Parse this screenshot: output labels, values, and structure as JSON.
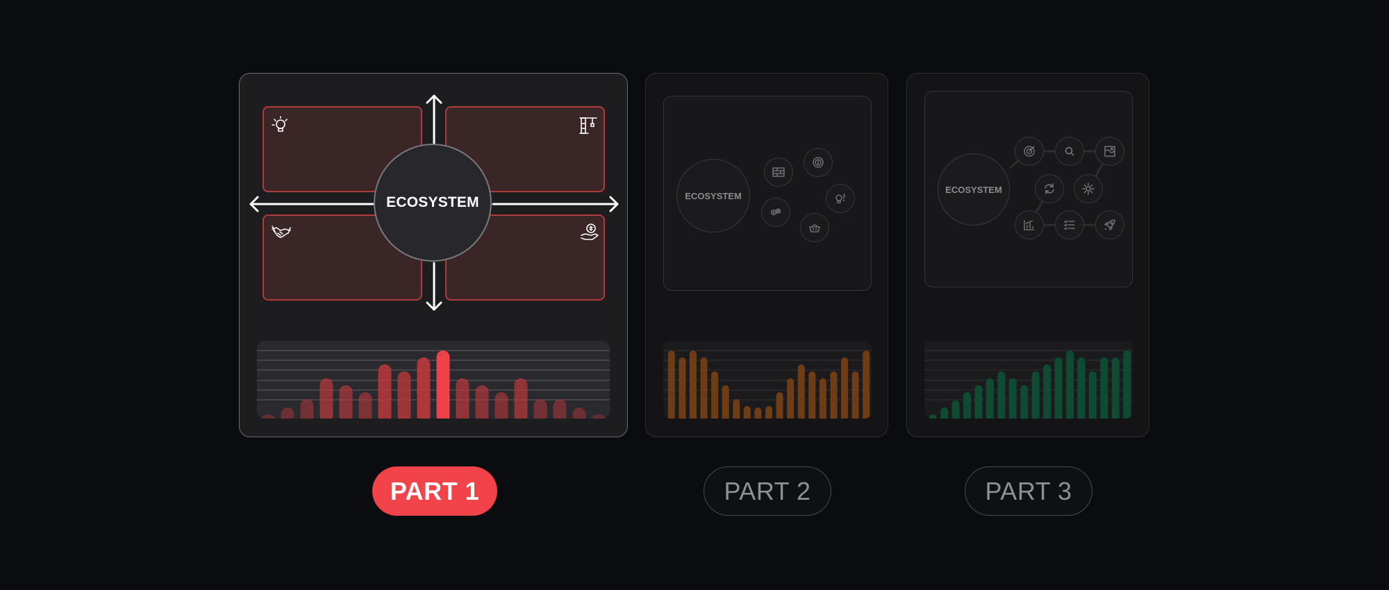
{
  "parts": [
    {
      "label": "PART 1",
      "diagram_label": "ECOSYSTEM",
      "quadrant_icons": [
        "lightbulb-idea-icon",
        "crane-icon",
        "handshake-icon",
        "money-hand-icon"
      ],
      "bars": [
        0.05,
        0.16,
        0.28,
        0.58,
        0.48,
        0.38,
        0.78,
        0.68,
        0.88,
        0.98,
        0.58,
        0.48,
        0.38,
        0.58,
        0.28,
        0.28,
        0.16,
        0.05
      ],
      "active_bar_index": 9,
      "colors": {
        "bar": "#b8383c",
        "bar_active": "#f2424a",
        "quad_border": "#b23a3d",
        "quad_fill": "#3a2527"
      }
    },
    {
      "label": "PART 2",
      "diagram_label": "ECOSYSTEM",
      "icons": [
        "bricks-icon",
        "compass-icon",
        "lightbulb-question-icon",
        "gears-icon",
        "basket-icon"
      ],
      "bars": [
        0.98,
        0.88,
        0.98,
        0.88,
        0.68,
        0.48,
        0.28,
        0.18,
        0.16,
        0.18,
        0.38,
        0.58,
        0.78,
        0.68,
        0.58,
        0.68,
        0.88,
        0.68,
        0.98
      ],
      "colors": {
        "bar": "#6e3d16"
      }
    },
    {
      "label": "PART 3",
      "diagram_label": "ECOSYSTEM",
      "icons": [
        "target-icon",
        "search-icon",
        "map-icon",
        "refresh-icon",
        "sparkle-icon",
        "chart-icon",
        "checklist-icon",
        "rocket-icon"
      ],
      "bars": [
        0.06,
        0.16,
        0.26,
        0.38,
        0.48,
        0.58,
        0.68,
        0.58,
        0.48,
        0.68,
        0.78,
        0.88,
        0.98,
        0.88,
        0.68,
        0.88,
        0.88,
        0.98
      ],
      "colors": {
        "bar": "#0f4b32"
      }
    }
  ]
}
